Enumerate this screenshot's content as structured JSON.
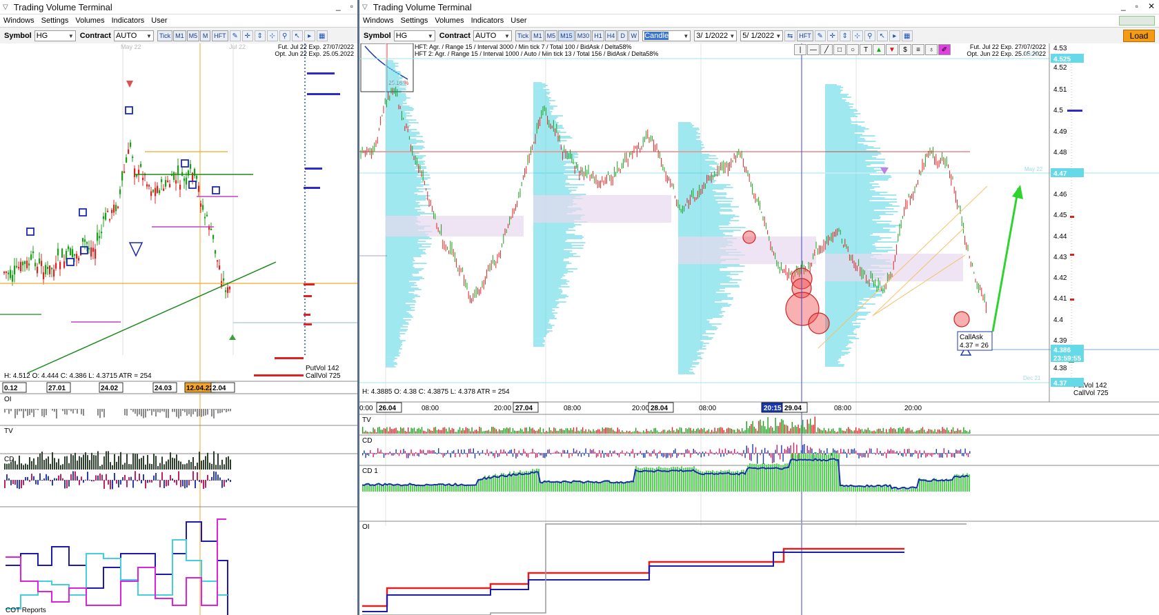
{
  "left": {
    "title": "Trading Volume Terminal",
    "menu": [
      "Windows",
      "Settings",
      "Volumes",
      "Indicators",
      "User"
    ],
    "toolbar": {
      "symbol_label": "Symbol",
      "symbol": "HG",
      "contract_label": "Contract",
      "contract": "AUTO",
      "timeframes": [
        "Tick",
        "M1",
        "M5",
        "M"
      ],
      "hft": "HFT"
    },
    "info": {
      "fut": "Fut. Jul 22 Exp. 27/07/2022",
      "opt": "Opt. Jun 22 Exp. 25.05.2022",
      "may": "May 22",
      "jul": "Jul 22"
    },
    "ohlc": "H: 4.512  O: 4.444  C: 4.386  L: 4.3715  ATR = 254",
    "putvol": "PutVol  142",
    "callvol": "CallVol  725",
    "dates": [
      "0.12",
      "27.01",
      "24.02",
      "24.03",
      "12.04.22",
      "2.04"
    ],
    "panels": [
      "OI",
      "TV",
      "CD"
    ],
    "cot": "COT Reports"
  },
  "right": {
    "title": "Trading Volume Terminal",
    "menu": [
      "Windows",
      "Settings",
      "Volumes",
      "Indicators",
      "User"
    ],
    "toolbar": {
      "symbol_label": "Symbol",
      "symbol": "HG",
      "contract_label": "Contract",
      "contract": "AUTO",
      "timeframes": [
        "Tick",
        "M1",
        "M5",
        "M15",
        "M30",
        "H1",
        "H4",
        "D",
        "W"
      ],
      "chart_type": "Candle",
      "date_from": "3/ 1/2022",
      "date_to": "5/ 1/2022",
      "hft": "HFT",
      "load": "Load"
    },
    "hft1": "HFT: Agr. / Range 15 / Interval 3000 / Min tick 7 / Total 100 / BidAsk / Delta58%",
    "hft2": "HFT 2: Agr. / Range 15 / Interval 1000 / Auto / Min tick 13 / Total 156 / BidAsk / Delta58%",
    "inset_pct": "25.16 %",
    "info": {
      "fut": "Fut. Jul 22 Exp. 27/07/2022",
      "opt": "Opt. Jun 22 Exp. 25.05.2022",
      "jul21": "Jul 21",
      "may22": "May 22",
      "dec21": "Dec 21"
    },
    "ohlc": "H: 4.3885  O: 4.38  C: 4.3875  L: 4.378  ATR = 254",
    "callask_title": "CallAsk",
    "callask_val": "4.37 = 26",
    "putvol": "PutVol  142",
    "callvol": "CallVol  725",
    "price_labels": [
      "4.53",
      "4.525",
      "4.52",
      "4.51",
      "4.5",
      "4.49",
      "4.48",
      "4.47",
      "4.46",
      "4.45",
      "4.44",
      "4.43",
      "4.42",
      "4.41",
      "4.4",
      "4.39",
      "4.386",
      "23:59:55",
      "4.38",
      "4.37"
    ],
    "time_labels": [
      "0:00",
      "26.04",
      "08:00",
      "20:00",
      "27.04",
      "08:00",
      "20:00",
      "28.04",
      "08:00",
      "20:15",
      "29.04",
      "08:00",
      "20:00"
    ],
    "panels": [
      "TV",
      "CD",
      "CD 1",
      "OI"
    ]
  },
  "colors": {
    "up": "#18a018",
    "down": "#e02020",
    "profile": "#66d9e8",
    "accent": "#1a3c8a",
    "orange": "#f5a623"
  }
}
